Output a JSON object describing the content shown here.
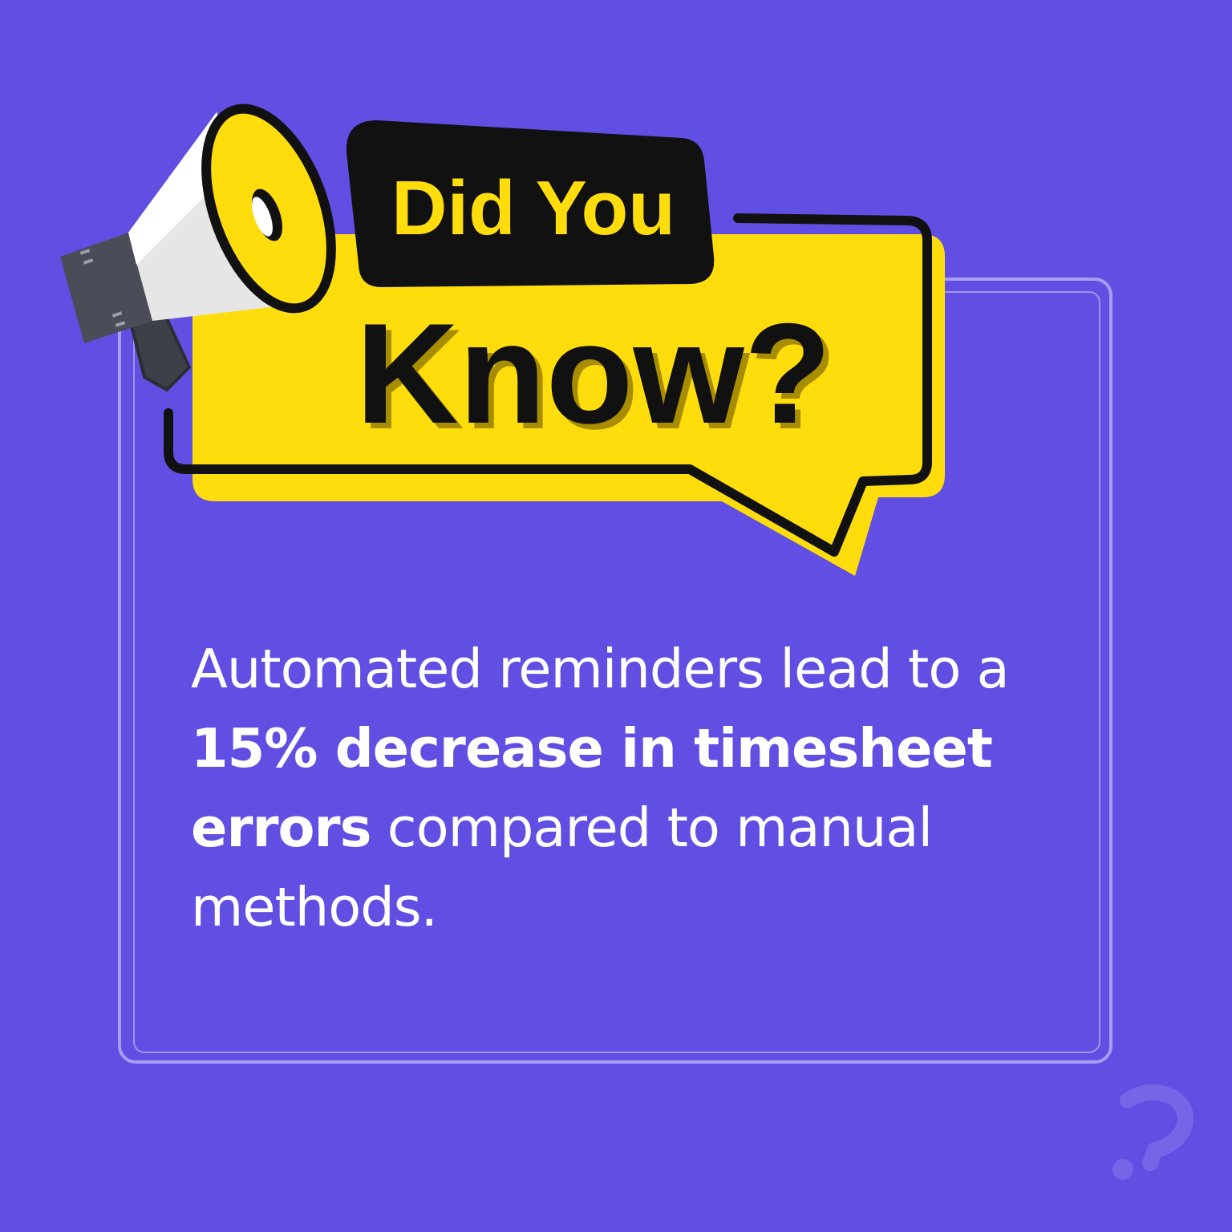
{
  "badge": {
    "line1": "Did You",
    "line2": "Know?"
  },
  "fact": {
    "part1": "Automated reminders lead to a",
    "part2_bold": "15% decrease in timesheet",
    "part3_bold": "errors",
    "part4": " compared to manual",
    "part5": "methods."
  },
  "colors": {
    "background": "#604fe2",
    "accent_yellow": "#ffdd0d",
    "outline": "#111111",
    "frame": "#a69ef3"
  },
  "icons": {
    "megaphone": "megaphone-icon",
    "corner": "question-mark-icon"
  }
}
